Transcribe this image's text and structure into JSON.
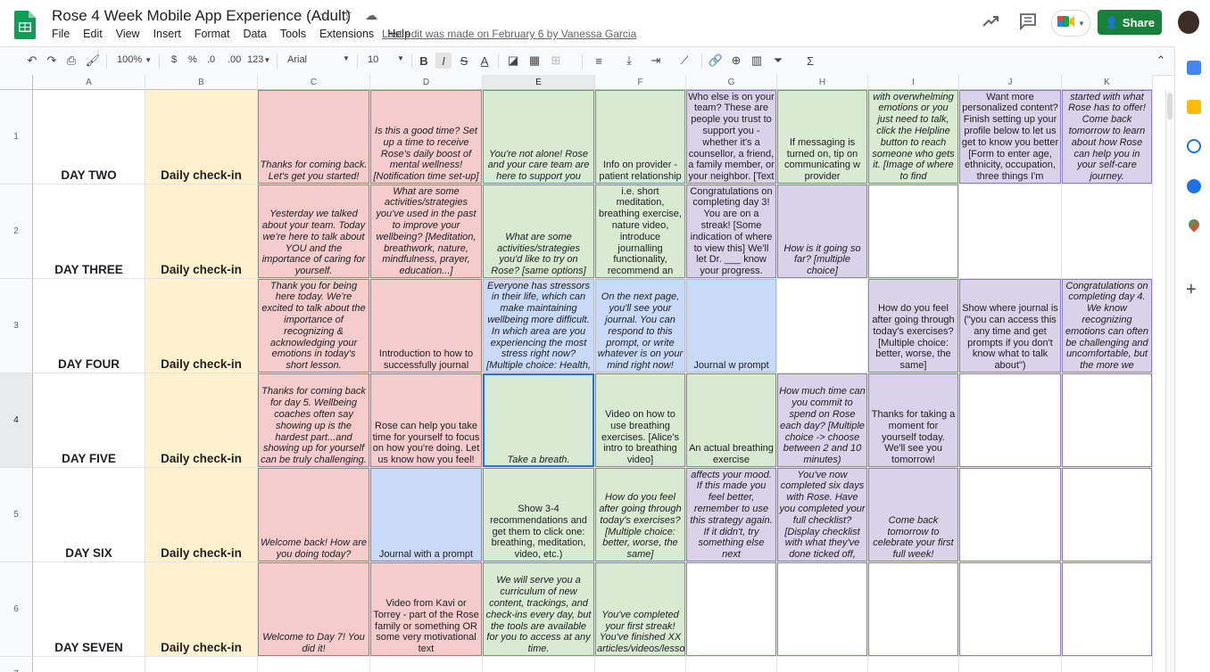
{
  "app": {
    "title": "Rose 4 Week Mobile App Experience (Adult)",
    "menu": [
      "File",
      "Edit",
      "View",
      "Insert",
      "Format",
      "Data",
      "Tools",
      "Extensions",
      "Help"
    ],
    "last_edit": "Last edit was made on February 6 by Vanessa Garcia",
    "share_label": "Share",
    "accent": "#188038"
  },
  "toolbar": {
    "zoom": "100%",
    "currency": "$",
    "percent": "%",
    "dec_less": ".0",
    "dec_more": ".00",
    "format_more": "123",
    "font": "Arial",
    "font_size": "10",
    "bold": "B",
    "italic": "I"
  },
  "columns": [
    "A",
    "B",
    "C",
    "D",
    "E",
    "F",
    "G",
    "H",
    "I",
    "J",
    "K"
  ],
  "rows": [
    {
      "num": "1",
      "cells": [
        "DAY TWO",
        "Daily check-in",
        "Thanks for coming back. Let's get you started!",
        "Is this a good time? Set up a time to receive Rose's daily boost of mental wellness! [Notification time set-up]",
        "You're not alone! Rose and your care team are here to support you",
        "Info on provider - patient relationship",
        "Who else is on your team? These are people you trust to support you - whether it's a counsellor, a friend, a family member, or your neighbor. [Text",
        "If messaging is turned on, tip on communicating w provider",
        "If you are dealing with overwhelming emotions or you just need to talk, click the Helpline button to reach someone who gets it. [Image of where to find",
        "Want more personalized content? Finish setting up your profile below to let us get to know you better [Form to enter age, ethnicity, occupation, three things I'm",
        "You're just getting started with what Rose has to offer! Come back tomorrow to learn about how Rose can help you in your self-care journey."
      ]
    },
    {
      "num": "2",
      "cells": [
        "DAY THREE",
        "Daily check-in",
        "Yesterday we talked about your team. Today we're here to talk about YOU and the importance of caring for yourself.",
        "What are some activities/strategies you've used in the past to improve your wellbeing? [Meditation, breathwork, nature, mindfulness, prayer, education...]",
        "What are some activities/strategies you'd like to try on Rose? [same options]",
        "Serve them up what they selected i.e. short meditation, breathing exercise, nature video, introduce journalling functionality, recommend an",
        "Congratulations on completing day 3! You are on a streak! [Some indication of where to view this] We'll let Dr. ___ know your progress.",
        "How is it going so far? [multiple choice]",
        "",
        "",
        ""
      ]
    },
    {
      "num": "3",
      "cells": [
        "DAY FOUR",
        "Daily check-in",
        "Thank you for being here today. We're excited to talk about the importance of recognizing & acknowledging your emotions in today's short lesson.",
        "Introduction to how to successfully journal",
        "Everyone has stressors in their life, which can make maintaining wellbeing more difficult. In which area are you experiencing the most stress right now? [Multiple choice: Health,",
        "On the next page, you'll see your journal. You can respond to this prompt, or write whatever is on your mind right now!",
        "Journal w prompt",
        "",
        "How do you feel after going through today's exercises? [Multiple choice: better, worse, the same]",
        "Show where journal is (\"you can access this any time and get prompts if you don't know what to talk about\")",
        "Congratulations on completing day 4. We know recognizing emotions can often be challenging and uncomfortable, but the more we"
      ]
    },
    {
      "num": "4",
      "cells": [
        "DAY FIVE",
        "Daily check-in",
        "Thanks for coming back for day 5. Wellbeing coaches often say showing up is the hardest part...and showing up for yourself can be truly challenging.",
        "Rose can help you take time for yourself to focus on how you're doing. Let us know how you feel!",
        "Take a breath.",
        "Video on how to use breathing exercises. [Alice's intro to breathing video]",
        "An actual breathing exercise",
        "How much time can you commit to spend on Rose each day? [Multiple choice -> choose between 2 and 10 minutes)",
        "Thanks for taking a moment for yourself today. We'll see you tomorrow!",
        "",
        ""
      ]
    },
    {
      "num": "5",
      "cells": [
        "DAY SIX",
        "Daily check-in",
        "Welcome back! How are you doing today?",
        "Journal with a prompt",
        "Show 3-4 recommendations and get them to click one: breathing, meditation, video, etc.)",
        "How do you feel after going through today's exercises? [Multiple choice: better, worse, the same]",
        "It's important to pay attention to what affects your mood. If this made you feel better, remember to use this strategy again. If it didn't, try something else next",
        "You've now completed six days with Rose. Have you completed your full checklist? [Display checklist with what they've done ticked off,",
        "Come back tomorrow to celebrate your first full week!",
        "",
        ""
      ]
    },
    {
      "num": "6",
      "cells": [
        "DAY SEVEN",
        "Daily check-in",
        "Welcome to Day 7! You did it!",
        "Video from Kavi or Torrey - part of the Rose family or something OR some very motivational text",
        "We will serve you a curriculum of new content, trackings, and check-ins every day, but the tools are available for you to access at any time.",
        "You've completed your first streak! You've finished XX articles/videos/lessons.",
        "",
        "",
        "",
        "",
        ""
      ]
    },
    {
      "num": "7",
      "cells": [
        "",
        "",
        "",
        "",
        "",
        "",
        "",
        "",
        "",
        "",
        ""
      ]
    }
  ]
}
